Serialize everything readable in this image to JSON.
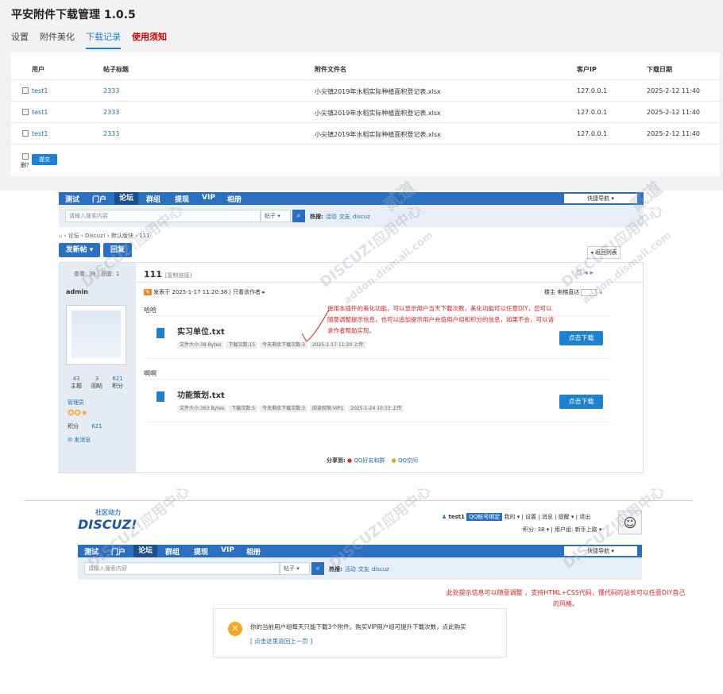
{
  "admin": {
    "title": "平安附件下载管理 1.0.5",
    "tabs": [
      "设置",
      "附件美化",
      "下载记录",
      "使用须知"
    ],
    "columns": [
      "用户",
      "帖子标题",
      "附件文件名",
      "客户IP",
      "下载日期"
    ],
    "rows": [
      {
        "user": "test1",
        "title": "2333",
        "file": "小尖镇2019年水稻实际种植面积登记表.xlsx",
        "ip": "127.0.0.1",
        "date": "2025-2-12 11:40"
      },
      {
        "user": "test1",
        "title": "2333",
        "file": "小尖镇2019年水稻实际种植面积登记表.xlsx",
        "ip": "127.0.0.1",
        "date": "2025-2-12 11:40"
      },
      {
        "user": "test1",
        "title": "2333",
        "file": "小尖镇2019年水稻实际种植面积登记表.xlsx",
        "ip": "127.0.0.1",
        "date": "2025-2-12 11:40"
      }
    ],
    "delete_label": "删?",
    "submit_label": "提交"
  },
  "nav": {
    "items": [
      "测试",
      "门户",
      "论坛",
      "群组",
      "提现",
      "VIP",
      "相册"
    ],
    "quick": "快捷导航 ▾",
    "search_placeholder": "请输入搜索内容",
    "search_type": "帖子 ▾",
    "hot_label": "热搜:",
    "hot_items": [
      "活动",
      "交友",
      "discuz"
    ]
  },
  "thread": {
    "breadcrumb": "› 论坛 › Discuz! › 默认版块 › 111",
    "post_btn": "发新帖 ▾",
    "reply_btn": "回复",
    "back_list": "◂ 返回列表",
    "views": "查看: 38",
    "replies": "回复: 1",
    "title": "111",
    "copy_link": "[复制链接]",
    "author": "admin",
    "posted": "发表于 2025-1-17 11:20:38",
    "only_author": "只看该作者 ▸",
    "floor": "楼主",
    "elevator": "电梯直达",
    "stats": [
      {
        "v": "43",
        "l": "主题"
      },
      {
        "v": "3",
        "l": "回帖"
      },
      {
        "v": "621",
        "l": "积分"
      }
    ],
    "group": "管理员",
    "score_label": "积分",
    "score": "621",
    "message": "发消息",
    "text1": "哈哈",
    "file1": "实习单位.txt",
    "file1_meta": [
      "文件大小:38 Bytes",
      "下载次数:15",
      "今天剩余下载次数:3",
      "2025-1-17 11:20 上传"
    ],
    "text2": "啊啊",
    "file2": "功能策划.txt",
    "file2_meta": [
      "文件大小:363 Bytes",
      "下载次数:5",
      "今天剩余下载次数:3",
      "阅读权限:VIP1",
      "2025-1-24 10:33 上传"
    ],
    "dl_btn": "点击下载",
    "share": "分享到:",
    "share_qq": "QQ好友和群",
    "share_zone": "QQ空间",
    "annotation": "使用本插件的美化功能，可以显示用户当天下载次数，美化功能可以任意DIY，您可以随意调整提示信息，也可以追加提示用户充值用户组和积分的信息，如果不会，可以请求作者帮助实现。"
  },
  "bottom": {
    "logo_top": "社区动力",
    "logo": "DISCUZ!",
    "user": "test1",
    "qq_bind": "QQ帐号绑定",
    "links": "我的 ▾ | 设置 | 消息 | 提醒 ▾ | 退出",
    "score": "积分: 38 ▾",
    "usergroup": "用户组: 新手上路 ▾",
    "annotation": "此处提示信息可以随意调整 ，支持HTML+CSS代码，懂代码的站长可以任意DIY自己的风格。",
    "notice": "你的当前用户组每天只能下载3个附件。购买VIP用户组可提升下载次数，点此购买",
    "back": "[ 点击这里返回上一页 ]"
  },
  "watermarks": [
    "DISCUZ!应用中心",
    "addon.dismall.com",
    "贰道"
  ]
}
